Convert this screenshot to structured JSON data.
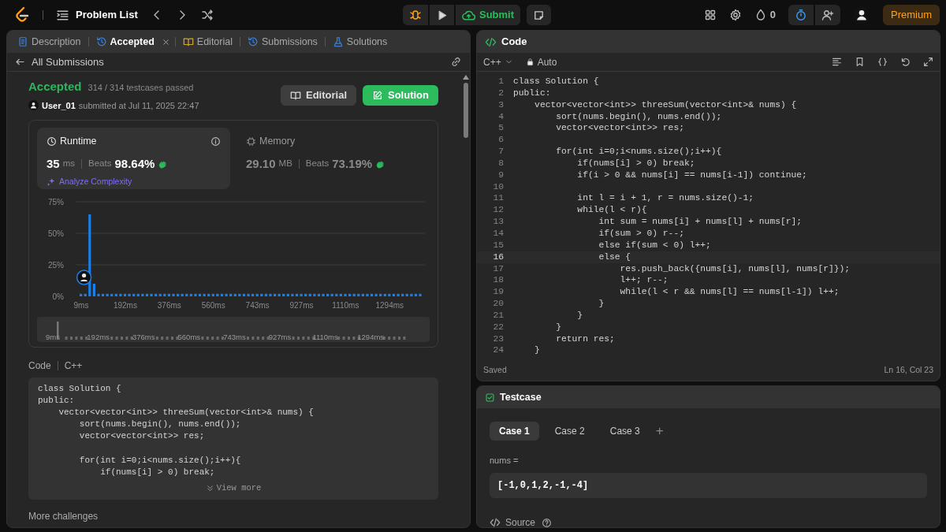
{
  "topbar": {
    "title": "Problem List",
    "submit": "Submit",
    "streak": "0",
    "premium": "Premium"
  },
  "left_tabs": [
    {
      "label": "Description",
      "kind": "doc",
      "selected": false
    },
    {
      "label": "Accepted",
      "kind": "history",
      "selected": true,
      "closable": true
    },
    {
      "label": "Editorial",
      "kind": "book",
      "selected": false
    },
    {
      "label": "Submissions",
      "kind": "history",
      "selected": false
    },
    {
      "label": "Solutions",
      "kind": "flask",
      "selected": false
    }
  ],
  "back_link": "All Submissions",
  "result": {
    "status": "Accepted",
    "passed": "314 / 314 testcases passed",
    "user": "User_01",
    "submitted": "submitted at Jul 11, 2025 22:47"
  },
  "actions": [
    {
      "label": "Editorial",
      "kind": "secondary"
    },
    {
      "label": "Solution",
      "kind": "primary"
    }
  ],
  "metrics": [
    {
      "kind": "clock",
      "label": "Runtime",
      "value": "35",
      "unit": "ms",
      "beats_label": "Beats",
      "beats": "98.64%",
      "selected": true,
      "link": "Analyze Complexity"
    },
    {
      "kind": "chip",
      "label": "Memory",
      "value": "29.10",
      "unit": "MB",
      "beats_label": "Beats",
      "beats": "73.19%",
      "selected": false
    }
  ],
  "chart_data": {
    "type": "bar",
    "ylim": [
      0,
      75
    ],
    "yticks": [
      {
        "value": 0,
        "label": "0%"
      },
      {
        "value": 25,
        "label": "25%"
      },
      {
        "value": 50,
        "label": "50%"
      },
      {
        "value": 75,
        "label": "75%"
      }
    ],
    "categories": [
      "9ms",
      null,
      null,
      null,
      null,
      null,
      null,
      null,
      null,
      null,
      "192ms",
      null,
      null,
      null,
      null,
      null,
      null,
      null,
      null,
      null,
      "376ms",
      null,
      null,
      null,
      null,
      null,
      null,
      null,
      null,
      null,
      "560ms",
      null,
      null,
      null,
      null,
      null,
      null,
      null,
      null,
      null,
      "743ms",
      null,
      null,
      null,
      null,
      null,
      null,
      null,
      null,
      null,
      "927ms",
      null,
      null,
      null,
      null,
      null,
      null,
      null,
      null,
      null,
      "1110ms",
      null,
      null,
      null,
      null,
      null,
      null,
      null,
      null,
      null,
      "1294ms",
      null,
      null,
      null,
      null,
      null,
      null,
      null
    ],
    "values": [
      2,
      2,
      65,
      10,
      2,
      2,
      2,
      2,
      2,
      2,
      2,
      2,
      2,
      2,
      2,
      2,
      2,
      2,
      2,
      2,
      2,
      2,
      2,
      2,
      2,
      2,
      2,
      2,
      2,
      2,
      2,
      2,
      2,
      2,
      2,
      2,
      2,
      2,
      2,
      2,
      2,
      2,
      2,
      2,
      2,
      2,
      2,
      2,
      2,
      2,
      2,
      2,
      2,
      2,
      2,
      2,
      2,
      2,
      2,
      2,
      2,
      2,
      2,
      2,
      2,
      2,
      2,
      2,
      2,
      2,
      2,
      2,
      2,
      2,
      2,
      2,
      2,
      2
    ]
  },
  "range_labels": [
    "9ms",
    "192ms",
    "376ms",
    "560ms",
    "743ms",
    "927ms",
    "1110ms",
    "1294ms"
  ],
  "code_preview": {
    "label": "Code",
    "language": "C++",
    "line_groups": [
      [
        "class Solution {",
        "public:",
        "    vector<vector<int>> threeSum(vector<int>& nums) {",
        "        sort(nums.begin(), nums.end());",
        "        vector<vector<int>> res;"
      ],
      [
        "        for(int i=0;i<nums.size();i++){",
        "            if(nums[i] > 0) break;"
      ]
    ],
    "more": "View more"
  },
  "more_challenges": "More challenges",
  "editor": {
    "title": "Code",
    "language": "C++",
    "mode": "Auto",
    "lines": [
      {
        "n": "1",
        "code": "class Solution {",
        "current": false
      },
      {
        "n": "2",
        "code": "public:",
        "current": false
      },
      {
        "n": "3",
        "code": "    vector<vector<int>> threeSum(vector<int>& nums) {",
        "current": false
      },
      {
        "n": "4",
        "code": "        sort(nums.begin(), nums.end());",
        "current": false
      },
      {
        "n": "5",
        "code": "        vector<vector<int>> res;",
        "current": false
      },
      {
        "n": "6",
        "current": false
      },
      {
        "n": "7",
        "code": "        for(int i=0;i<nums.size();i++){",
        "current": false
      },
      {
        "n": "8",
        "code": "            if(nums[i] > 0) break;",
        "current": false
      },
      {
        "n": "9",
        "code": "            if(i > 0 && nums[i] == nums[i-1]) continue;",
        "current": false
      },
      {
        "n": "10",
        "current": false
      },
      {
        "n": "11",
        "code": "            int l = i + 1, r = nums.size()-1;",
        "current": false
      },
      {
        "n": "12",
        "code": "            while(l < r){",
        "current": false
      },
      {
        "n": "13",
        "code": "                int sum = nums[i] + nums[l] + nums[r];",
        "current": false
      },
      {
        "n": "14",
        "code": "                if(sum > 0) r--;",
        "current": false
      },
      {
        "n": "15",
        "code": "                else if(sum < 0) l++;",
        "current": false
      },
      {
        "n": "16",
        "code": "                else {",
        "current": true
      },
      {
        "n": "17",
        "code": "                    res.push_back({nums[i], nums[l], nums[r]});",
        "current": false
      },
      {
        "n": "18",
        "code": "                    l++; r--;",
        "current": false
      },
      {
        "n": "19",
        "code": "                    while(l < r && nums[l] == nums[l-1]) l++;",
        "current": false
      },
      {
        "n": "20",
        "code": "                }",
        "current": false
      },
      {
        "n": "21",
        "code": "            }",
        "current": false
      },
      {
        "n": "22",
        "code": "        }",
        "current": false
      },
      {
        "n": "23",
        "code": "        return res;",
        "current": false
      },
      {
        "n": "24",
        "code": "    }",
        "current": false
      }
    ],
    "status": "Saved",
    "position": "Ln 16, Col 23"
  },
  "testcase": {
    "title": "Testcase",
    "cases": [
      {
        "label": "Case 1",
        "selected": true
      },
      {
        "label": "Case 2",
        "selected": false
      },
      {
        "label": "Case 3",
        "selected": false
      }
    ],
    "add": "+",
    "param": "nums =",
    "value": "[-1,0,1,2,-1,-4]",
    "source": "Source"
  }
}
